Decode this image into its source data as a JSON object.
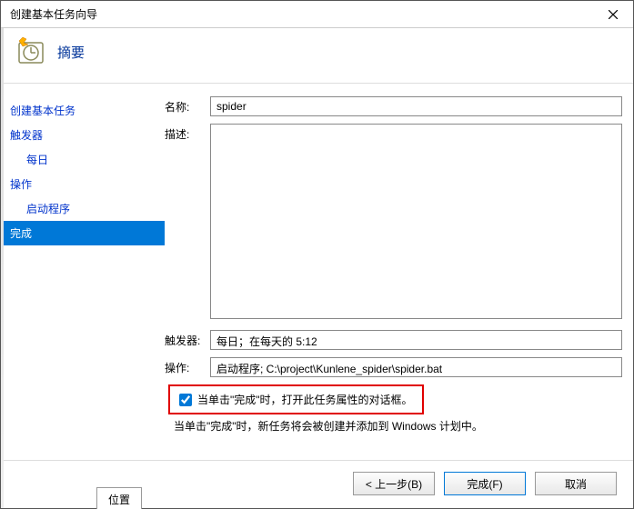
{
  "window": {
    "title": "创建基本任务向导"
  },
  "header": {
    "title": "摘要"
  },
  "sidebar": {
    "items": [
      {
        "label": "创建基本任务",
        "type": "item",
        "selected": false
      },
      {
        "label": "触发器",
        "type": "item",
        "selected": false
      },
      {
        "label": "每日",
        "type": "sub",
        "selected": false
      },
      {
        "label": "操作",
        "type": "item",
        "selected": false
      },
      {
        "label": "启动程序",
        "type": "sub",
        "selected": false
      },
      {
        "label": "完成",
        "type": "item",
        "selected": true
      }
    ]
  },
  "form": {
    "name_label": "名称:",
    "name_value": "spider",
    "desc_label": "描述:",
    "desc_value": "",
    "trigger_label": "触发器:",
    "trigger_value": "每日；在每天的 5:12",
    "action_label": "操作:",
    "action_value": "启动程序; C:\\project\\Kunlene_spider\\spider.bat",
    "checkbox_label": "当单击\"完成\"时，打开此任务属性的对话框。",
    "note_text": "当单击\"完成\"时，新任务将会被创建并添加到 Windows 计划中。"
  },
  "footer": {
    "back": "< 上一步(B)",
    "finish": "完成(F)",
    "cancel": "取消"
  },
  "bottom_tab": "位置"
}
